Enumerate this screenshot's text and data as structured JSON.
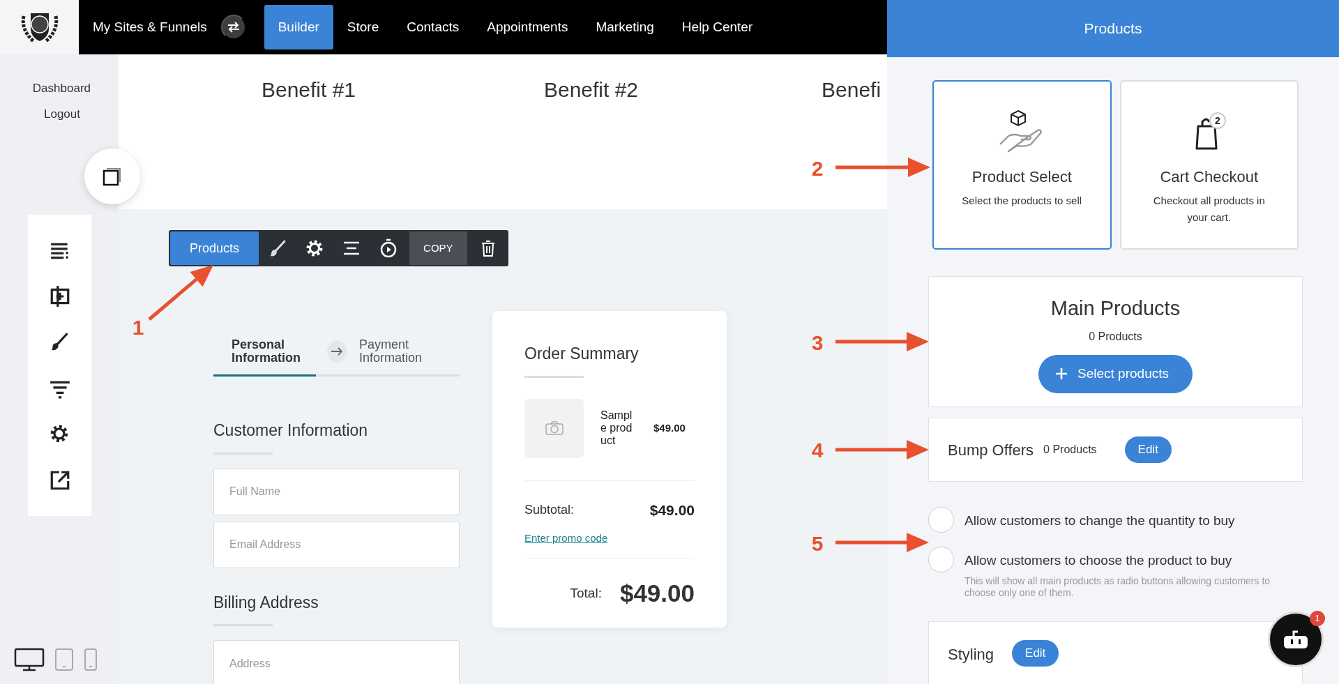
{
  "top_nav": {
    "items": [
      {
        "label": "My Sites & Funnels",
        "kind": "switcher",
        "selected": false
      },
      {
        "label": "Builder",
        "kind": "link",
        "selected": true
      },
      {
        "label": "Store",
        "kind": "link",
        "selected": false
      },
      {
        "label": "Contacts",
        "kind": "link",
        "selected": false
      },
      {
        "label": "Appointments",
        "kind": "link",
        "selected": false
      },
      {
        "label": "Marketing",
        "kind": "link",
        "selected": false
      },
      {
        "label": "Help Center",
        "kind": "link",
        "selected": false
      }
    ]
  },
  "sidebar": {
    "links": [
      "Dashboard",
      "Logout"
    ],
    "devices": [
      {
        "kind": "desktop",
        "selected": true
      },
      {
        "kind": "tablet",
        "selected": false
      },
      {
        "kind": "phone",
        "selected": false
      }
    ]
  },
  "canvas": {
    "benefits": [
      "Benefit #1",
      "Benefit #2",
      "Benefi"
    ],
    "element_toolbar": {
      "label": "Products",
      "copy": "COPY"
    },
    "steps": [
      {
        "label": "Personal Information",
        "selected": true
      },
      {
        "label": "Payment Information",
        "selected": false
      }
    ],
    "customer_heading": "Customer Information",
    "customer_fields": [
      {
        "placeholder": "Full Name"
      },
      {
        "placeholder": "Email Address"
      }
    ],
    "billing_heading": "Billing Address",
    "billing_fields": [
      {
        "placeholder": "Address"
      }
    ],
    "order_summary": {
      "title": "Order Summary",
      "item_name": "Sample product",
      "item_price": "$49.00",
      "subtotal_label": "Subtotal:",
      "subtotal_value": "$49.00",
      "promo_link": "Enter promo code",
      "total_label": "Total:",
      "total_value": "$49.00"
    }
  },
  "panel": {
    "title": "Products",
    "types": [
      {
        "title": "Product Select",
        "description": "Select the products to sell",
        "kind": "hand",
        "selected": true
      },
      {
        "title": "Cart Checkout",
        "description": "Checkout all products in your cart.",
        "kind": "bag",
        "badge": "2",
        "selected": false
      }
    ],
    "main_products": {
      "title": "Main Products",
      "count": "0 Products",
      "button": "Select products"
    },
    "bump_offers": {
      "title": "Bump Offers",
      "count": "0 Products",
      "button": "Edit"
    },
    "options": [
      {
        "label": "Allow customers to change the quantity to buy",
        "checked": false
      },
      {
        "label": "Allow customers to choose the product to buy",
        "hint": "This will show all main products as radio buttons allowing customers to choose only one of them.",
        "checked": false
      }
    ],
    "styling": {
      "title": "Styling",
      "button": "Edit"
    }
  },
  "chat": {
    "badge": "1"
  },
  "annotations": [
    {
      "number": "1"
    },
    {
      "number": "2"
    },
    {
      "number": "3"
    },
    {
      "number": "4"
    },
    {
      "number": "5"
    }
  ]
}
